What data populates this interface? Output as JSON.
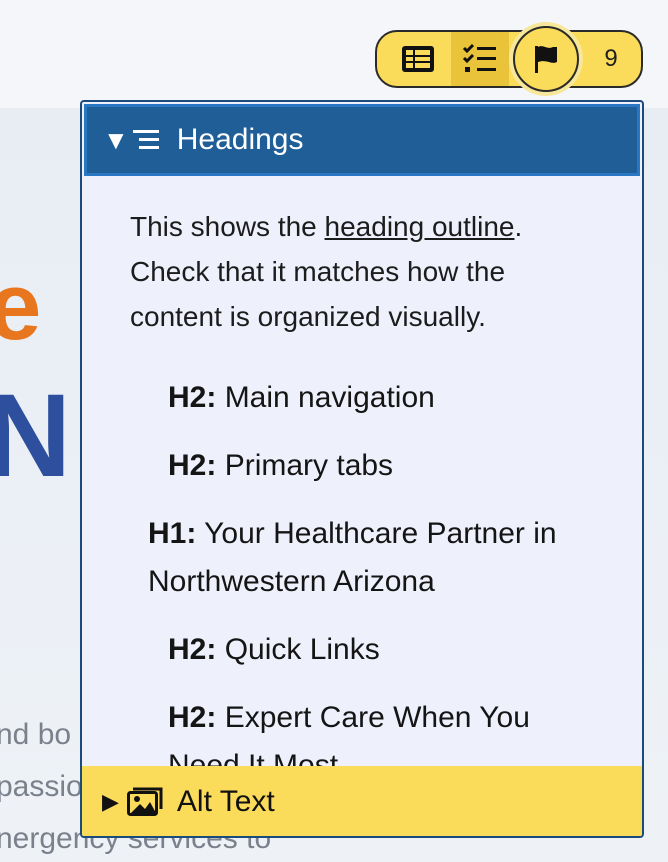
{
  "background": {
    "letter_e": "e",
    "letter_n": "N",
    "lines": [
      "nd bo",
      "passio",
      "nergency services to"
    ]
  },
  "toolbar": {
    "table_icon": "table-icon",
    "checklist_icon": "checklist-icon",
    "flag_icon": "flag-icon",
    "count": "9"
  },
  "panel": {
    "header_title": "Headings",
    "intro_before": "This shows the ",
    "intro_link": "heading outline",
    "intro_after": ". Check that it matches how the content is organized visually.",
    "headings": [
      {
        "level": "H2:",
        "text": "Main navigation"
      },
      {
        "level": "H2:",
        "text": "Primary tabs"
      },
      {
        "level": "H1:",
        "text": "Your Healthcare Partner in Northwestern Arizona"
      },
      {
        "level": "H2:",
        "text": "Quick Links"
      },
      {
        "level": "H2:",
        "text": "Expert Care When You Need It Most"
      }
    ],
    "footer_title": "Alt Text"
  },
  "colors": {
    "accent_yellow": "#fbdb5a",
    "header_blue": "#1f5e96",
    "panel_bg": "#eef0fc",
    "brand_orange": "#e8761e",
    "brand_blue": "#2d4f9e"
  }
}
